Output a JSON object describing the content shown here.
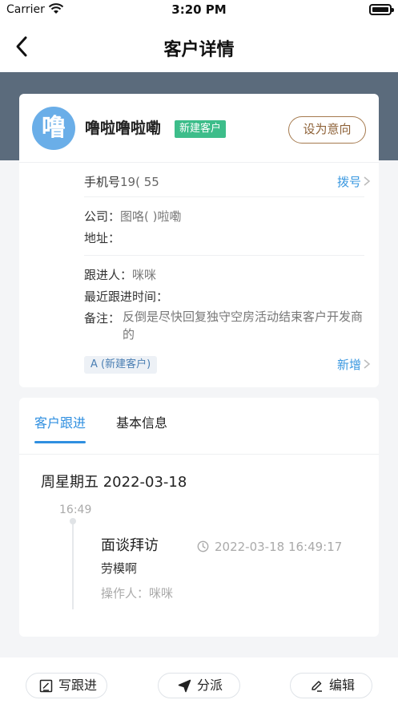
{
  "status_bar": {
    "carrier": "Carrier",
    "time": "3:20 PM"
  },
  "nav": {
    "title": "客户详情"
  },
  "customer": {
    "avatar_char": "噜",
    "name": "噜啦噜啦嘞",
    "tag": "新建客户",
    "intent_button": "设为意向",
    "phone_label": "手机号",
    "phone_value": "19(          55",
    "dial_link": "拨号",
    "company_label": "公司：",
    "company_value": "图咯(        )啦嘞",
    "address_label": "地址：",
    "follower_label": "跟进人：",
    "follower_value": "咪咪",
    "last_follow_label": "最近跟进时间：",
    "note_label": "备注：",
    "note_value": "反倒是尽快回复独守空房活动结束客户开发商的",
    "level_chip": "A (新建客户)",
    "add_link": "新增"
  },
  "follow": {
    "tabs": [
      {
        "label": "客户跟进"
      },
      {
        "label": "基本信息"
      }
    ],
    "date_heading": "周星期五 2022-03-18",
    "time_mark": "16:49",
    "event": {
      "title": "面谈拜访",
      "timestamp": "2022-03-18 16:49:17",
      "content": "劳模啊",
      "operator_label": "操作人：",
      "operator_value": "咪咪"
    }
  },
  "bottom": {
    "write_follow": "写跟进",
    "assign": "分派",
    "edit": "编辑"
  },
  "colors": {
    "accent": "#2f8fe0",
    "header_band": "#5b6b7c",
    "tag_green": "#3dbd8a",
    "intent_brown": "#a57a4e"
  }
}
